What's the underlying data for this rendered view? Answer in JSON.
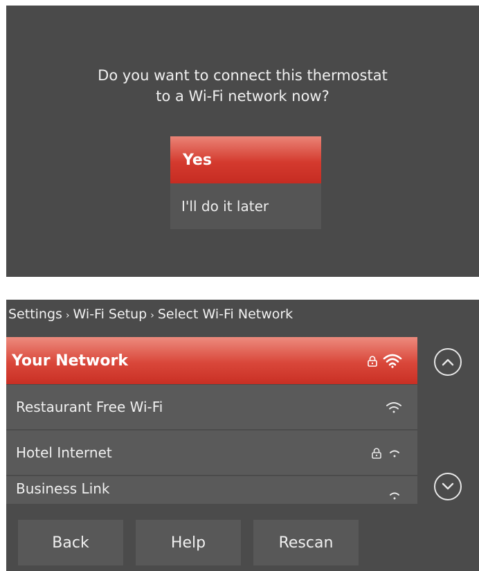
{
  "connect_dialog": {
    "prompt_line1": "Do you want to connect this thermostat",
    "prompt_line2": "to a Wi-Fi network now?",
    "yes_label": "Yes",
    "later_label": "I'll do it later"
  },
  "wifi_setup": {
    "breadcrumb": [
      "Settings",
      "Wi-Fi Setup",
      "Select Wi-Fi Network"
    ],
    "breadcrumb_separator": "›",
    "networks": [
      {
        "name": "Your Network",
        "locked": true,
        "signal": "strong",
        "selected": true
      },
      {
        "name": "Restaurant Free Wi-Fi",
        "locked": false,
        "signal": "medium",
        "selected": false
      },
      {
        "name": "Hotel Internet",
        "locked": true,
        "signal": "weak",
        "selected": false
      },
      {
        "name": "Business Link",
        "locked": false,
        "signal": "weak",
        "selected": false
      }
    ],
    "back_label": "Back",
    "help_label": "Help",
    "rescan_label": "Rescan"
  },
  "colors": {
    "panel_bg": "#4a4a4a",
    "accent_red": "#d43a2e",
    "list_row_bg": "#5a5a5a",
    "text_light": "#f0f0f0"
  }
}
